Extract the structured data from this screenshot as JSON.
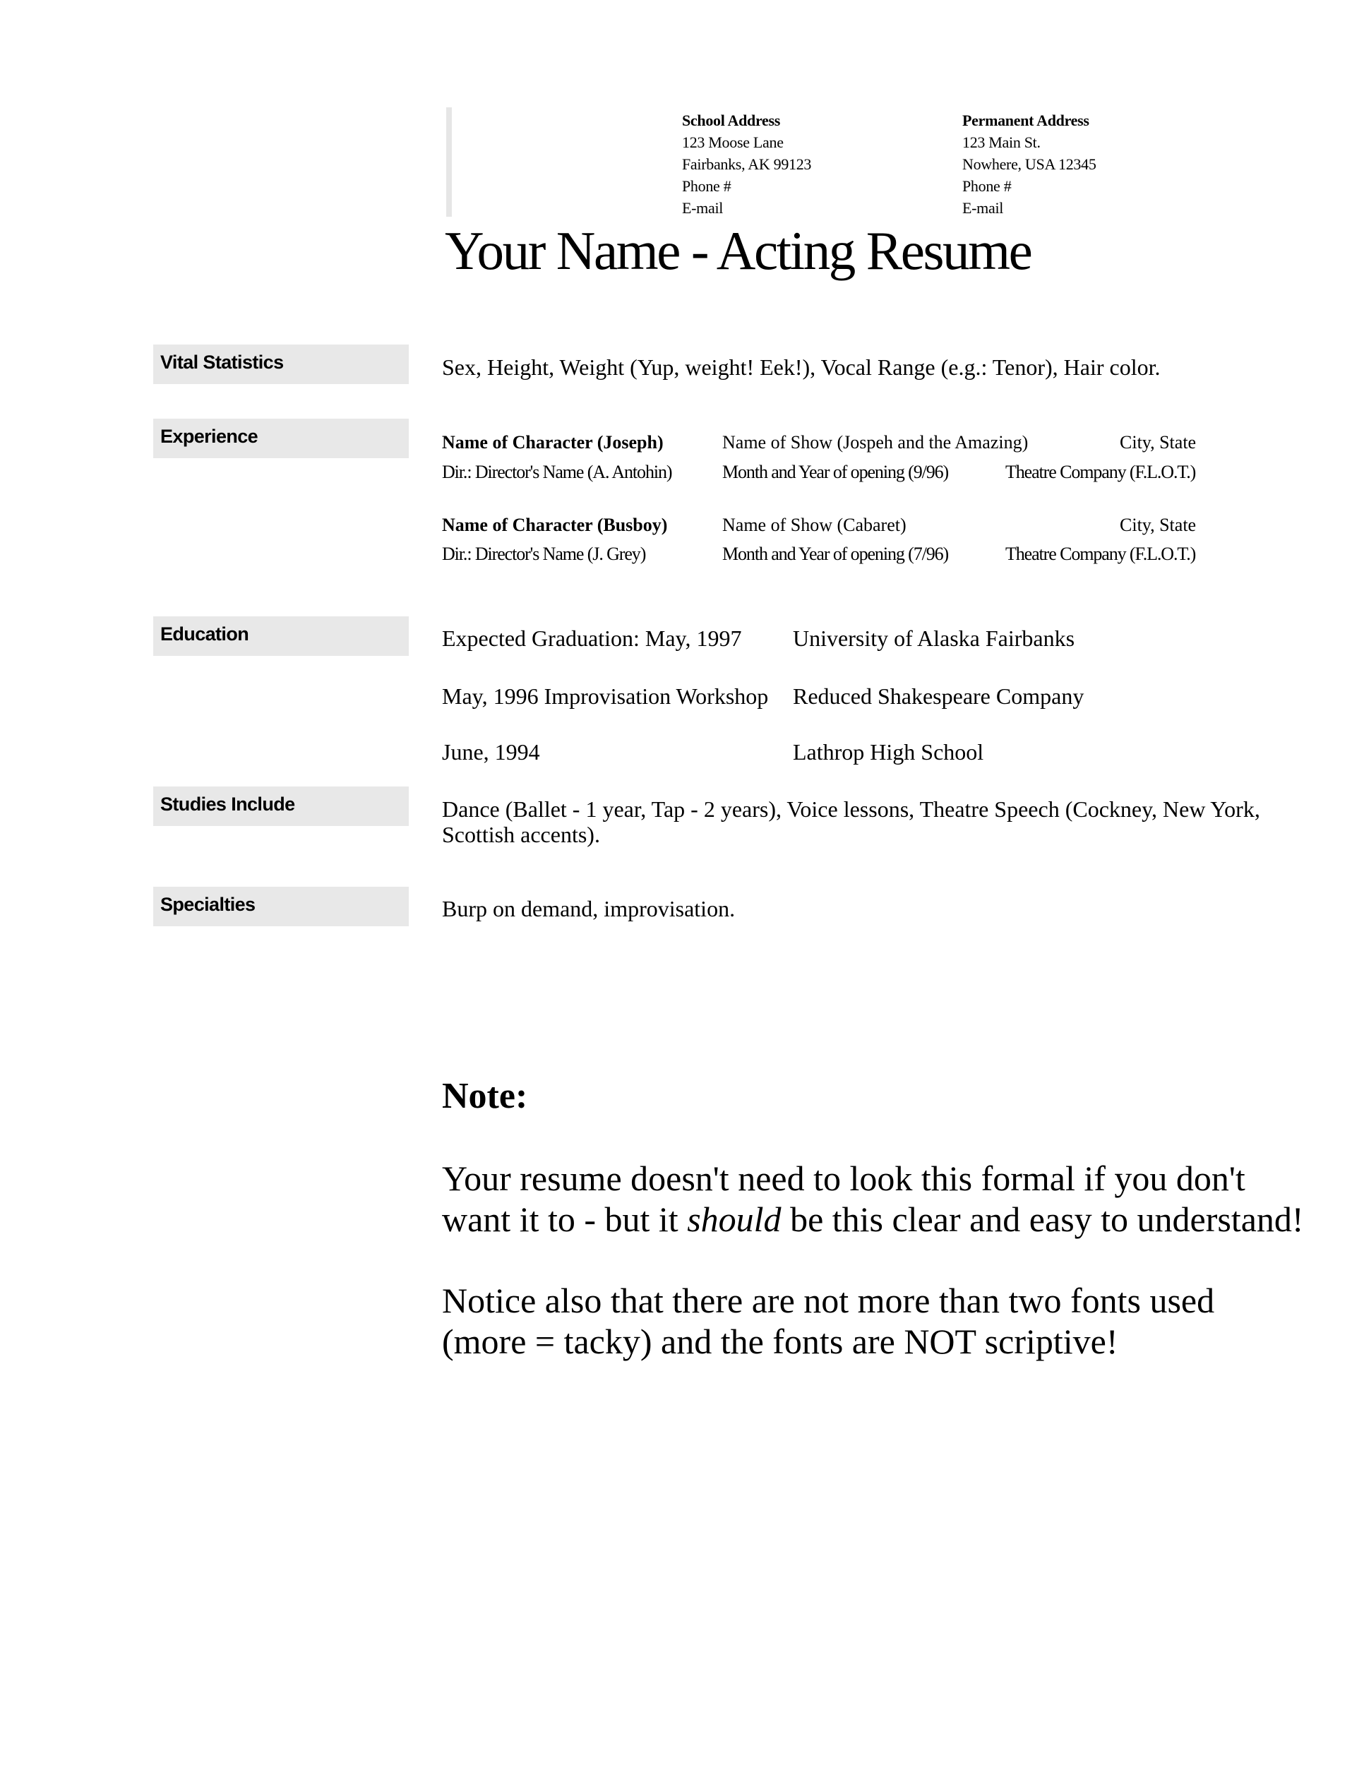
{
  "header": {
    "school_address": {
      "heading": "School Address",
      "lines": [
        "123 Moose Lane",
        "Fairbanks, AK 99123",
        "Phone #",
        "E-mail"
      ]
    },
    "permanent_address": {
      "heading": "Permanent Address",
      "lines": [
        "123 Main St.",
        "Nowhere, USA 12345",
        "Phone #",
        "E-mail"
      ]
    },
    "title": "Your Name - Acting Resume"
  },
  "sections": {
    "vital_statistics": {
      "label": "Vital Statistics",
      "text": "Sex, Height, Weight (Yup, weight!  Eek!), Vocal Range (e.g.: Tenor), Hair color."
    },
    "experience": {
      "label": "Experience",
      "entries": [
        {
          "character": "Name of Character (Joseph)",
          "show": "Name of Show (Jospeh and the Amazing)",
          "location": "City, State",
          "director": "Dir.: Director's Name (A. Antohin)",
          "opening": "Month and Year of opening (9/96)",
          "company": "Theatre Company (F.L.O.T.)"
        },
        {
          "character": "Name of Character (Busboy)",
          "show": "Name of Show (Cabaret)",
          "location": "City, State",
          "director": "Dir.: Director's Name (J. Grey)",
          "opening": "Month and Year of opening (7/96)",
          "company": "Theatre Company (F.L.O.T.)"
        }
      ]
    },
    "education": {
      "label": "Education",
      "rows": [
        {
          "when": "Expected Graduation: May, 1997",
          "where": "University of Alaska Fairbanks"
        },
        {
          "when": "May, 1996 Improvisation Workshop",
          "where": "Reduced Shakespeare Company"
        },
        {
          "when": "June, 1994",
          "where": "Lathrop High School"
        }
      ]
    },
    "studies_include": {
      "label": "Studies Include",
      "lines": [
        "Dance (Ballet - 1 year, Tap - 2 years), Voice lessons, Theatre Speech (Cockney, New York,",
        "Scottish accents)."
      ]
    },
    "specialties": {
      "label": "Specialties",
      "text": "Burp on demand, improvisation."
    }
  },
  "note": {
    "heading": "Note:",
    "paragraph1": {
      "line1": "Your resume doesn't need to look this formal if you don't",
      "line2_before": "want it to - but it ",
      "line2_emphasis": "should",
      "line2_after": " be this clear and easy to understand!"
    },
    "paragraph2": {
      "line1": "Notice also that there are not more than two fonts used",
      "line2": "(more = tacky) and the fonts are NOT scriptive!"
    }
  }
}
